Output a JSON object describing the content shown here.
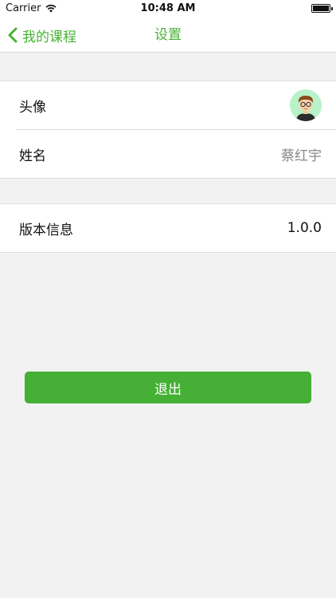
{
  "status_bar": {
    "carrier": "Carrier",
    "time": "10:48 AM",
    "battery_level": 1.0
  },
  "nav": {
    "back_label": "我的课程",
    "title": "设置",
    "accent_color": "#48b135"
  },
  "profile": {
    "avatar_label": "头像",
    "name_label": "姓名",
    "name_value": "蔡红宇"
  },
  "about": {
    "version_label": "版本信息",
    "version_value": "1.0.0"
  },
  "actions": {
    "logout_label": "退出",
    "logout_color": "#45b035"
  }
}
